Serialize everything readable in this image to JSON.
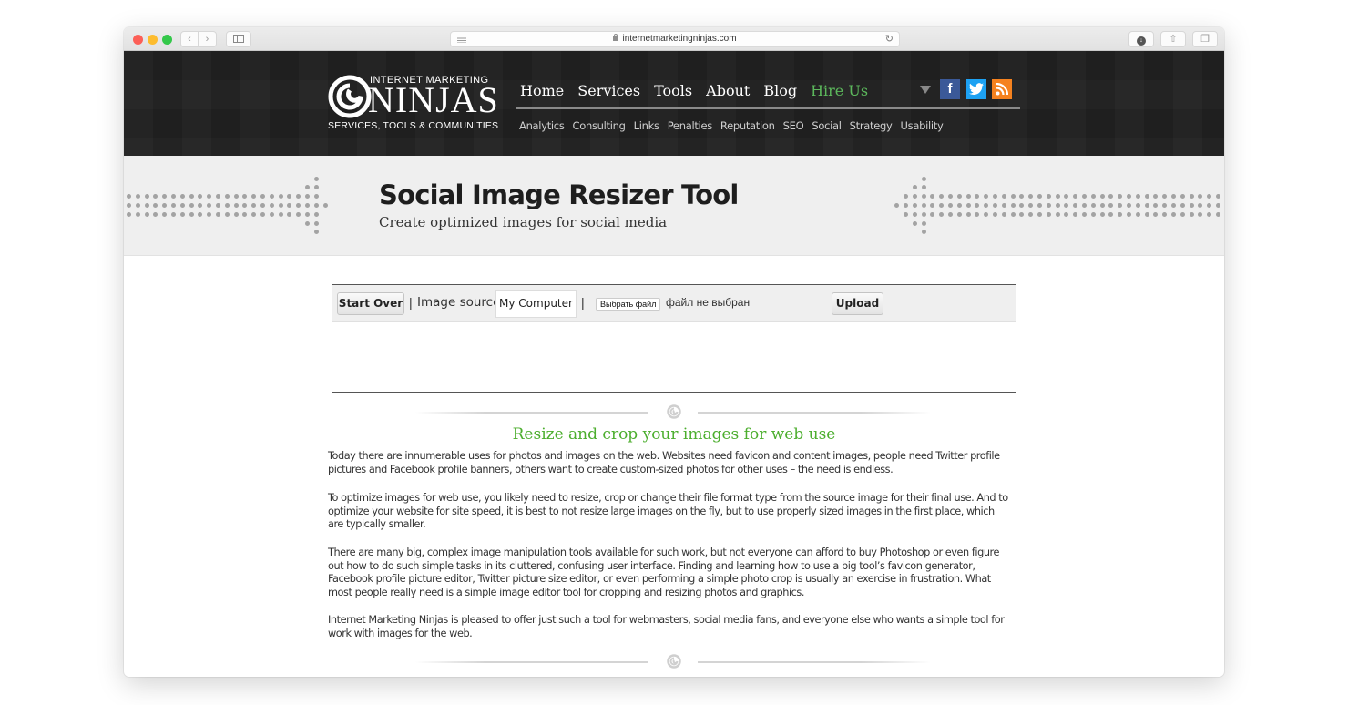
{
  "browser": {
    "url": "internetmarketingninjas.com",
    "icons": {
      "back": "chevron-left-icon",
      "forward": "chevron-right-icon",
      "sidebar": "sidebar-icon",
      "reader": "reader-icon",
      "lock": "lock-icon",
      "reload": "reload-icon",
      "downloads": "download-icon",
      "share": "share-icon",
      "tabs": "tabs-icon"
    },
    "glyphs": {
      "back": "‹",
      "forward": "›",
      "reload": "↻",
      "download": "↓",
      "share": "⇧",
      "tabs": "❐"
    }
  },
  "header": {
    "logo": {
      "top": "INTERNET MARKETING",
      "main": "NINJAS",
      "sub": "SERVICES, TOOLS & COMMUNITIES"
    },
    "main_nav": [
      {
        "label": "Home"
      },
      {
        "label": "Services"
      },
      {
        "label": "Tools"
      },
      {
        "label": "About"
      },
      {
        "label": "Blog"
      },
      {
        "label": "Hire Us",
        "highlight": true
      }
    ],
    "sub_nav": [
      "Analytics",
      "Consulting",
      "Links",
      "Penalties",
      "Reputation",
      "SEO",
      "Social",
      "Strategy",
      "Usability"
    ],
    "social": [
      {
        "name": "facebook",
        "glyph": "f",
        "color": "#3b5998"
      },
      {
        "name": "twitter",
        "glyph": "t",
        "color": "#1da1f2"
      },
      {
        "name": "rss",
        "glyph": "◉",
        "color": "#f5821f"
      }
    ],
    "accent_color": "#5cb85c"
  },
  "banner": {
    "title": "Social Image Resizer Tool",
    "subtitle": "Create optimized images for social media"
  },
  "tool": {
    "start_over": "Start Over",
    "separator": "|",
    "image_source_label": "Image source:",
    "image_source_value": "My Computer",
    "file_button": "Выбрать файл",
    "file_status": "файл не выбран",
    "upload": "Upload"
  },
  "content": {
    "heading": "Resize and crop your images for web use",
    "heading_color": "#4cae2e",
    "paragraphs": [
      "Today there are innumerable uses for photos and images on the web. Websites need favicon and content images, people need Twitter profile pictures and Facebook profile banners, others want to create custom-sized photos for other uses – the need is endless.",
      "To optimize images for web use, you likely need to resize, crop or change their file format type from the source image for their final use. And to optimize your website for site speed, it is best to not resize large images on the fly, but to use properly sized images in the first place, which are typically smaller.",
      "There are many big, complex image manipulation tools available for such work, but not everyone can afford to buy Photoshop or even figure out how to do such simple tasks in its cluttered, confusing user interface. Finding and learning how to use a big tool’s favicon generator, Facebook profile picture editor, Twitter picture size editor, or even performing a simple photo crop is usually an exercise in frustration. What most people really need is a simple image editor tool for cropping and resizing photos and graphics.",
      "Internet Marketing Ninjas is pleased to offer just such a tool for webmasters, social media fans, and everyone else who wants a simple tool for work with images for the web."
    ]
  }
}
